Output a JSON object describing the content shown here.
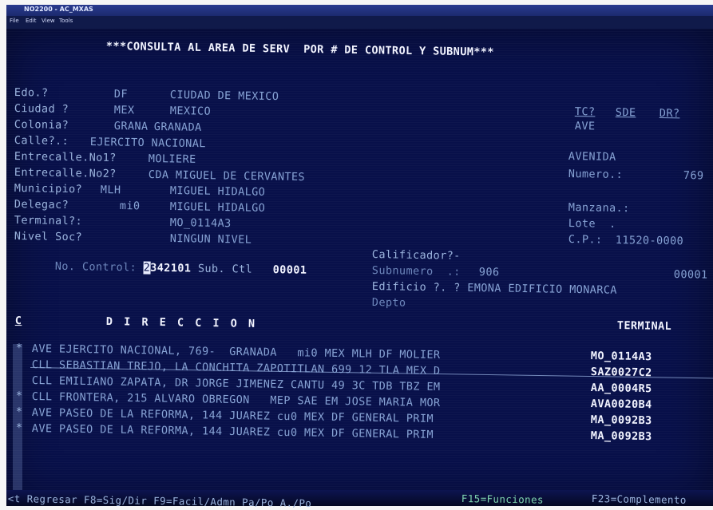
{
  "window": {
    "title": "NO2200 - AC_MXAS",
    "menu": [
      "File",
      "Edit",
      "View",
      "Tools"
    ]
  },
  "header": "***CONSULTA AL AREA DE SERV  POR # DE CONTROL Y SUBNUM***",
  "fields": {
    "edo": {
      "label": "Edo.?",
      "code": "DF",
      "name": "CIUDAD DE MEXICO"
    },
    "ciudad": {
      "label": "Ciudad ?",
      "code": "MEX",
      "name": "MEXICO"
    },
    "colonia": {
      "label": "Colonia?",
      "code": "GRANA",
      "name": "GRANADA"
    },
    "calle": {
      "label": "Calle?.:",
      "value": "EJERCITO NACIONAL"
    },
    "entrecalle1": {
      "label": "Entrecalle.No1?",
      "value": "MOLIERE"
    },
    "entrecalle2": {
      "label": "Entrecalle.No2?",
      "value": "CDA MIGUEL DE CERVANTES"
    },
    "municipio": {
      "label": "Municipio?",
      "code": "MLH",
      "name": "MIGUEL HIDALGO"
    },
    "delegac": {
      "label": "Delegac?",
      "code": "mi0",
      "name": "MIGUEL HIDALGO"
    },
    "terminal": {
      "label": "Terminal?:",
      "value": "MO_0114A3"
    },
    "nivel": {
      "label": "Nivel Soc?",
      "value": "NINGUN NIVEL"
    },
    "control": {
      "label_a": "No.",
      "label_b": "Control:",
      "cursor_char": "2",
      "value": "342101",
      "sub_label": "Sub. Ctl",
      "sub_value": "00001"
    }
  },
  "right": {
    "tc": "TC?",
    "sde": "SDE",
    "dr": "DR?",
    "tc_value": "AVE",
    "tipo": "AVENIDA",
    "numero_label": "Numero.:",
    "numero_value": "769",
    "manzana_label": "Manzana.:",
    "lote_label": "Lote  .",
    "cp_label": "C.P.:",
    "cp_value": "11520-0000",
    "calificador_label": "Calificador?-",
    "subnumero_label": "Subnumero  .:",
    "subnumero_value": "906",
    "subnumero_right": "00001",
    "edificio_label": "Edificio ?. ?",
    "edificio_value": "EMONA EDIFICIO MONARCA",
    "depto_label": "Depto"
  },
  "table": {
    "col_c": "C",
    "col_dir": "D I R E C C I O N",
    "col_term": "TERMINAL",
    "rows": [
      {
        "c": "*",
        "dir": "AVE EJERCITO NACIONAL, 769-  GRANADA   mi0 MEX MLH DF MOLIER",
        "term": "MO_0114A3"
      },
      {
        "c": "",
        "dir": "CLL SEBASTIAN TREJO, LA CONCHITA ZAPOTITLAN 699 12 TLA MEX D",
        "term": "SAZ0027C2"
      },
      {
        "c": "",
        "dir": "CLL EMILIANO ZAPATA, DR JORGE JIMENEZ CANTU 49 3C TDB TBZ EM",
        "term": "AA_0004R5"
      },
      {
        "c": "*",
        "dir": "CLL FRONTERA, 215 ALVARO OBREGON   MEP SAE EM JOSE MARIA MOR",
        "term": "AVA0020B4"
      },
      {
        "c": "*",
        "dir": "AVE PASEO DE LA REFORMA, 144 JUAREZ cu0 MEX DF GENERAL PRIM",
        "term": "MA_0092B3"
      },
      {
        "c": "*",
        "dir": "AVE PASEO DE LA REFORMA, 144 JUAREZ cu0 MEX DF GENERAL PRIM",
        "term": "MA_0092B3"
      }
    ]
  },
  "footer": {
    "part1": "<t Regresar F8=Sig/Dir F9=Facil/Admn Pa/Po A./Po",
    "part2": "F15=Funciones",
    "part3": "F23=Complemento"
  },
  "colors": {
    "screen_bg": "#08104a",
    "label": "#9bb4de",
    "highlight": "#f2f4ff",
    "terminal_green": "#7ed3b0"
  }
}
